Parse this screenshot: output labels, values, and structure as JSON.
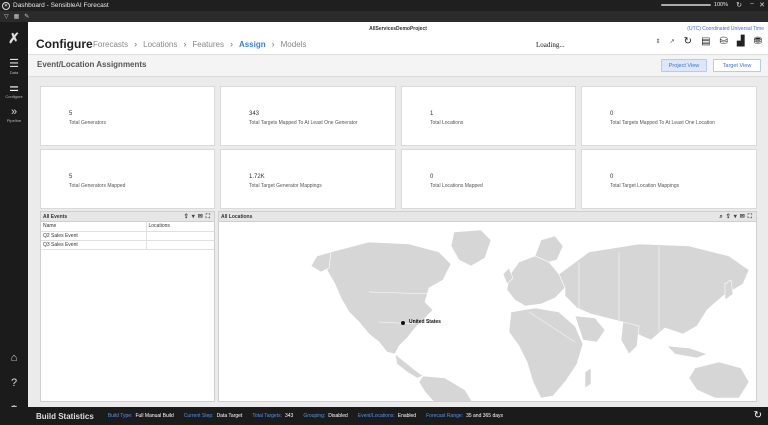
{
  "window": {
    "title": "Dashboard - SensibleAI Forecast",
    "zoom": "100%"
  },
  "nav": {
    "items": [
      {
        "id": "data",
        "label": "Data",
        "icon": "database-icon"
      },
      {
        "id": "configure",
        "label": "Configure",
        "icon": "sliders-icon",
        "active": true
      },
      {
        "id": "pipeline",
        "label": "Pipeline",
        "icon": "chevrons-icon"
      }
    ]
  },
  "header": {
    "project": "AllServicesDemoProject",
    "timezone": "(UTC) Coordinated Universal Time",
    "page_title": "Configure",
    "breadcrumbs": [
      "Forecasts",
      "Locations",
      "Features",
      "Assign",
      "Models"
    ],
    "active_crumb": "Assign",
    "loading_text": "Loading..."
  },
  "section": {
    "title": "Event/Location Assignments",
    "project_view": "Project View",
    "target_view": "Target View"
  },
  "metrics": [
    {
      "value": "5",
      "label": "Total Generators"
    },
    {
      "value": "343",
      "label": "Total Targets Mapped To At Least One Generator"
    },
    {
      "value": "1",
      "label": "Total Locations"
    },
    {
      "value": "0",
      "label": "Total Targets Mapped To At Least One Location"
    },
    {
      "value": "5",
      "label": "Total Generators Mapped"
    },
    {
      "value": "1.72K",
      "label": "Total Target Generator Mappings"
    },
    {
      "value": "0",
      "label": "Total Locations Mapped"
    },
    {
      "value": "0",
      "label": "Total Target Location Mappings"
    }
  ],
  "events_panel": {
    "title": "All Events",
    "columns": [
      "Name",
      "Locations"
    ],
    "rows": [
      [
        "Q2 Sales Event",
        ""
      ],
      [
        "Q3 Sales Event",
        ""
      ]
    ]
  },
  "locations_panel": {
    "title": "All Locations",
    "marker_label": "United States"
  },
  "status": {
    "title": "Build Statistics",
    "items": [
      {
        "key": "Build Type:",
        "value": "Full Manual Build"
      },
      {
        "key": "Current Step:",
        "value": "Data Target"
      },
      {
        "key": "Total Targets:",
        "value": "343"
      },
      {
        "key": "Grouping:",
        "value": "Disabled"
      },
      {
        "key": "Event/Locations:",
        "value": "Enabled"
      },
      {
        "key": "Forecast Range:",
        "value": "35 and 365 days"
      }
    ]
  }
}
